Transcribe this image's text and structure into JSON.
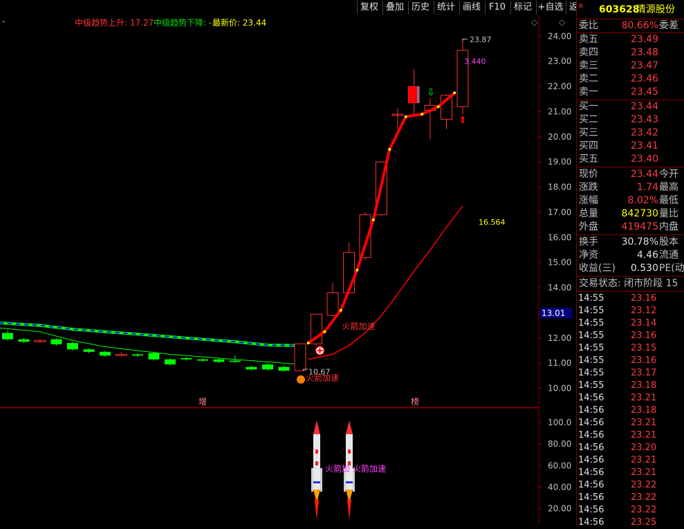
{
  "toolbar": {
    "buttons": [
      "复权",
      "叠加",
      "历史",
      "统计",
      "画线",
      "F10",
      "标记",
      "+自选",
      "返回"
    ]
  },
  "legend": {
    "dash": "-",
    "up_label": "中级趋势上升: 17.27",
    "down_label": "中级趋势下降: -",
    "latest_label": "最新价: 23.44"
  },
  "chart_labels": {
    "high_marker": "23.87",
    "low_marker": "10.67",
    "ma_value": "3.440",
    "curve_value": "16.564",
    "rocket_text_main": "火箭加速",
    "rocket_text_low": "火箭加速",
    "current_price_box": "13.01",
    "bottom_left": "增",
    "bottom_mid": "榜",
    "sub_text_1": "火箭加",
    "sub_text_2": "火箭加速"
  },
  "colors": {
    "up": "#ff3232",
    "down": "#00ff00",
    "axis": "#800000",
    "trend_line": "#ff0000",
    "ma_green": "#00ff00",
    "ma_blue": "#0000ff"
  },
  "chart_data": {
    "type": "candlestick",
    "price_axis": [
      "24.00",
      "23.00",
      "22.00",
      "21.00",
      "20.00",
      "19.00",
      "18.00",
      "17.00",
      "16.00",
      "15.00",
      "14.00",
      "13.00",
      "12.00",
      "11.00",
      "10.00"
    ],
    "price_axis_values": [
      24,
      23,
      22,
      21,
      20,
      19,
      18,
      17,
      16,
      15,
      14,
      13,
      12,
      11,
      10
    ],
    "sub_axis": [
      "100.0",
      "80.00",
      "60.00",
      "40.00",
      "20.00"
    ],
    "sub_axis_values": [
      100,
      80,
      60,
      40,
      20
    ],
    "ylim": [
      9.3,
      24.45
    ],
    "sub_ylim": [
      5,
      107
    ],
    "candles": [
      {
        "o": 12.2,
        "c": 11.95,
        "h": 12.3,
        "l": 11.9
      },
      {
        "o": 11.95,
        "c": 11.85,
        "h": 12.0,
        "l": 11.8
      },
      {
        "o": 11.85,
        "c": 11.9,
        "h": 11.95,
        "l": 11.8
      },
      {
        "o": 11.95,
        "c": 11.75,
        "h": 12.0,
        "l": 11.7
      },
      {
        "o": 11.8,
        "c": 11.55,
        "h": 11.85,
        "l": 11.5
      },
      {
        "o": 11.55,
        "c": 11.45,
        "h": 11.6,
        "l": 11.4
      },
      {
        "o": 11.45,
        "c": 11.3,
        "h": 11.5,
        "l": 11.25
      },
      {
        "o": 11.3,
        "c": 11.35,
        "h": 11.45,
        "l": 11.25
      },
      {
        "o": 11.35,
        "c": 11.3,
        "h": 11.4,
        "l": 11.25
      },
      {
        "o": 11.4,
        "c": 11.15,
        "h": 11.45,
        "l": 11.1
      },
      {
        "o": 11.15,
        "c": 10.95,
        "h": 11.2,
        "l": 10.9
      },
      {
        "o": 11.2,
        "c": 11.15,
        "h": 11.25,
        "l": 11.1
      },
      {
        "o": 11.15,
        "c": 11.1,
        "h": 11.2,
        "l": 11.05
      },
      {
        "o": 11.15,
        "c": 11.05,
        "h": 11.2,
        "l": 11.0
      },
      {
        "o": 11.1,
        "c": 11.05,
        "h": 11.3,
        "l": 11.0
      },
      {
        "o": 10.85,
        "c": 10.75,
        "h": 10.9,
        "l": 10.7
      },
      {
        "o": 10.95,
        "c": 10.75,
        "h": 11.0,
        "l": 10.7
      },
      {
        "o": 10.85,
        "c": 10.7,
        "h": 10.9,
        "l": 10.67
      },
      {
        "o": 10.7,
        "c": 11.77,
        "h": 11.77,
        "l": 10.67
      },
      {
        "o": 11.77,
        "c": 12.95,
        "h": 12.95,
        "l": 11.7
      },
      {
        "o": 12.9,
        "c": 13.8,
        "h": 14.2,
        "l": 12.85
      },
      {
        "o": 13.8,
        "c": 15.4,
        "h": 15.8,
        "l": 13.75
      },
      {
        "o": 15.2,
        "c": 16.9,
        "h": 17.0,
        "l": 15.1
      },
      {
        "o": 16.9,
        "c": 19.0,
        "h": 19.0,
        "l": 16.85
      },
      {
        "o": 20.85,
        "c": 20.9,
        "h": 21.15,
        "l": 20.3
      },
      {
        "o": 21.35,
        "c": 22.0,
        "h": 22.7,
        "l": 20.85
      },
      {
        "o": 21.05,
        "c": 21.25,
        "h": 21.55,
        "l": 19.9
      },
      {
        "o": 20.7,
        "c": 21.65,
        "h": 21.7,
        "l": 20.3
      },
      {
        "o": 21.2,
        "c": 23.44,
        "h": 23.87,
        "l": 20.9
      }
    ],
    "trend_line": [
      {
        "i": 18.5,
        "v": 11.8
      },
      {
        "i": 19.5,
        "v": 12.25
      },
      {
        "i": 20.5,
        "v": 13.1
      },
      {
        "i": 21.5,
        "v": 14.7
      },
      {
        "i": 22.5,
        "v": 16.7
      },
      {
        "i": 23.5,
        "v": 19.5
      },
      {
        "i": 24.5,
        "v": 20.8
      },
      {
        "i": 25.5,
        "v": 20.9
      },
      {
        "i": 26.5,
        "v": 21.2
      },
      {
        "i": 27.5,
        "v": 21.75
      }
    ],
    "ma_line": [
      {
        "i": 18.5,
        "v": 11.15
      },
      {
        "i": 20,
        "v": 11.35
      },
      {
        "i": 21,
        "v": 11.7
      },
      {
        "i": 22,
        "v": 12.2
      },
      {
        "i": 23,
        "v": 12.9
      },
      {
        "i": 24,
        "v": 13.75
      },
      {
        "i": 25,
        "v": 14.65
      },
      {
        "i": 26,
        "v": 15.5
      },
      {
        "i": 27,
        "v": 16.4
      },
      {
        "i": 28,
        "v": 17.25
      }
    ],
    "ma_green": [
      {
        "i": -0.5,
        "v": 12.6
      },
      {
        "i": 2,
        "v": 12.5
      },
      {
        "i": 4,
        "v": 12.35
      },
      {
        "i": 6,
        "v": 12.25
      },
      {
        "i": 8,
        "v": 12.15
      },
      {
        "i": 10,
        "v": 12.05
      },
      {
        "i": 12,
        "v": 11.95
      },
      {
        "i": 14,
        "v": 11.85
      },
      {
        "i": 16,
        "v": 11.72
      },
      {
        "i": 18,
        "v": 11.7
      }
    ],
    "ma_green_low": [
      {
        "i": -0.5,
        "v": 12.4
      },
      {
        "i": 2,
        "v": 12.25
      },
      {
        "i": 4,
        "v": 11.9
      },
      {
        "i": 6,
        "v": 11.65
      },
      {
        "i": 8,
        "v": 11.5
      },
      {
        "i": 10,
        "v": 11.35
      },
      {
        "i": 12,
        "v": 11.25
      },
      {
        "i": 14,
        "v": 11.15
      },
      {
        "i": 16,
        "v": 11.05
      },
      {
        "i": 18,
        "v": 10.95
      }
    ]
  },
  "panel": {
    "stock_code": "603628",
    "stock_name": "清源股份",
    "r_mark": "R",
    "weibi_label": "委比",
    "weibi_value": "80.66%",
    "weicha_label": "委差",
    "asks": [
      {
        "label": "卖五",
        "price": "23.49"
      },
      {
        "label": "卖四",
        "price": "23.48"
      },
      {
        "label": "卖三",
        "price": "23.47"
      },
      {
        "label": "卖二",
        "price": "23.46"
      },
      {
        "label": "卖一",
        "price": "23.45"
      }
    ],
    "bids": [
      {
        "label": "买一",
        "price": "23.44"
      },
      {
        "label": "买二",
        "price": "23.43"
      },
      {
        "label": "买三",
        "price": "23.42"
      },
      {
        "label": "买四",
        "price": "23.41"
      },
      {
        "label": "买五",
        "price": "23.40"
      }
    ],
    "stats": [
      {
        "label": "现价",
        "value": "23.44",
        "right": "今开",
        "cls": "red"
      },
      {
        "label": "涨跌",
        "value": "1.74",
        "right": "最高",
        "cls": "red"
      },
      {
        "label": "涨幅",
        "value": "8.02%",
        "right": "最低",
        "cls": "red"
      },
      {
        "label": "总量",
        "value": "842730",
        "right": "量比",
        "cls": "yel"
      },
      {
        "label": "外盘",
        "value": "419475",
        "right": "内盘",
        "cls": "red"
      }
    ],
    "stats2": [
      {
        "label": "换手",
        "value": "30.78%",
        "right": "股本"
      },
      {
        "label": "净资",
        "value": "4.46",
        "right": "流通"
      },
      {
        "label": "收益(三)",
        "value": "0.530",
        "right": "PE(动"
      }
    ],
    "trade_status": "交易状态: 闭市阶段 15",
    "ticks": [
      {
        "t": "14:55",
        "p": "23.16"
      },
      {
        "t": "14:55",
        "p": "23.12"
      },
      {
        "t": "14:55",
        "p": "23.14"
      },
      {
        "t": "14:55",
        "p": "23.16"
      },
      {
        "t": "14:55",
        "p": "23.15"
      },
      {
        "t": "14:55",
        "p": "23.16"
      },
      {
        "t": "14:55",
        "p": "23.17"
      },
      {
        "t": "14:55",
        "p": "23.18"
      },
      {
        "t": "14:56",
        "p": "23.21"
      },
      {
        "t": "14:56",
        "p": "23.18"
      },
      {
        "t": "14:56",
        "p": "23.21"
      },
      {
        "t": "14:56",
        "p": "23.21"
      },
      {
        "t": "14:56",
        "p": "23.20"
      },
      {
        "t": "14:56",
        "p": "23.21"
      },
      {
        "t": "14:56",
        "p": "23.21"
      },
      {
        "t": "14:56",
        "p": "23.22"
      },
      {
        "t": "14:56",
        "p": "23.22"
      },
      {
        "t": "14:56",
        "p": "23.22"
      },
      {
        "t": "14:56",
        "p": "23.25"
      }
    ]
  }
}
